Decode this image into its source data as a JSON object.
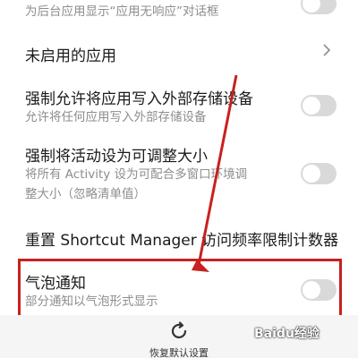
{
  "settings": {
    "item0": {
      "subtitle": "为后台应用显示“应用无响应”对话框",
      "toggle_on": false
    },
    "item1": {
      "title": "未启用的应用"
    },
    "item2": {
      "title": "强制允许将应用写入外部存储设备",
      "subtitle": "允许将任何应用写入外部存储设备",
      "toggle_on": false
    },
    "item3": {
      "title": "强制将活动设为可调整大小",
      "subtitle_line1": "将所有 Activity 设为可配合多窗口环境调",
      "subtitle_line2": "整大小（忽略清单值）",
      "toggle_on": false
    },
    "item4": {
      "title": "重置 Shortcut Manager 访问频率限制计数器"
    },
    "item5": {
      "title": "气泡通知",
      "subtitle": "部分通知以气泡形式显示",
      "toggle_on": false
    }
  },
  "bottom_bar": {
    "restore_label": "恢复默认设置"
  },
  "watermark": {
    "text": "Baidu经验"
  },
  "colors": {
    "highlight": "#c8211f",
    "arrow": "#c8211f",
    "toggle_off": "#d9d9d9"
  },
  "icons": {
    "chevron": "chevron-right-icon",
    "restore": "refresh-icon"
  }
}
